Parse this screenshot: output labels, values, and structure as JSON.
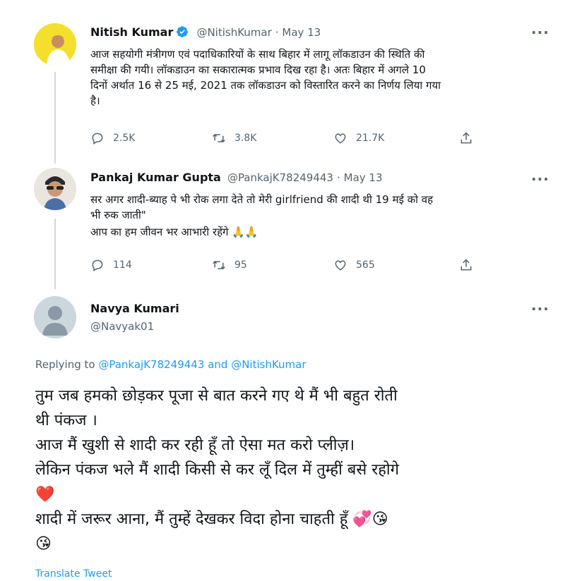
{
  "tweet1": {
    "name": "Nitish Kumar",
    "handle": "@NitishKumar",
    "date": "May 13",
    "lines": [
      "आज सहयोगी मंत्रीगण एवं पदाधिकारियों के साथ बिहार में लागू लॉकडाउन की स्थिति की",
      "समीक्षा की गयी। लॉकडाउन का सकारात्मक प्रभाव दिख रहा है। अतः बिहार में अगले 10",
      "दिनों अर्थात 16 से 25 मई, 2021 तक लॉकडाउन को विस्तारित करने का निर्णय लिया गया",
      "है।"
    ],
    "replies": "2.5K",
    "retweets": "3.8K",
    "likes": "21.7K"
  },
  "tweet2": {
    "name": "Pankaj Kumar Gupta",
    "handle": "@PankajK78249443",
    "date": "May 13",
    "lines": [
      "सर अगर शादी-ब्याह पे भी रोक लगा देते तो मेरी girlfriend की शादी थी 19 मई को वह",
      "भी रुक जाती\"",
      "आप का हम जीवन भर आभारी रहेंगे 🙏🙏"
    ],
    "replies": "114",
    "retweets": "95",
    "likes": "565"
  },
  "tweet3": {
    "name": "Navya Kumari",
    "handle": "@Navyak01",
    "replying_prefix": "Replying to",
    "replying_user1": "@PankajK78249443",
    "replying_and": "and",
    "replying_user2": "@NitishKumar",
    "lines": [
      "तुम जब हमको छोड़कर पूजा से बात करने गए थे मैं भी बहुत रोती",
      "थी पंकज ।",
      "आज मैं खुशी से शादी कर रही हूँ तो ऐसा मत करो प्लीज़।",
      "लेकिन पंकज भले मैं शादी किसी से कर लूँ दिल में तुम्हीं बसे रहोगे",
      "❤️",
      "शादी में जरूर आना, मैं तुम्हें देखकर विदा होना चाहती हूँ 💞😘",
      "😘"
    ],
    "translate": "Translate Tweet"
  },
  "more_glyph": "···",
  "icons": {
    "reply": "reply-icon",
    "retweet": "retweet-icon",
    "like": "heart-icon",
    "share": "share-icon",
    "more": "more-icon",
    "verified": "verified-badge-icon"
  },
  "colors": {
    "link": "#1d9bf0",
    "muted": "#536471",
    "verified": "#1d9bf0"
  }
}
